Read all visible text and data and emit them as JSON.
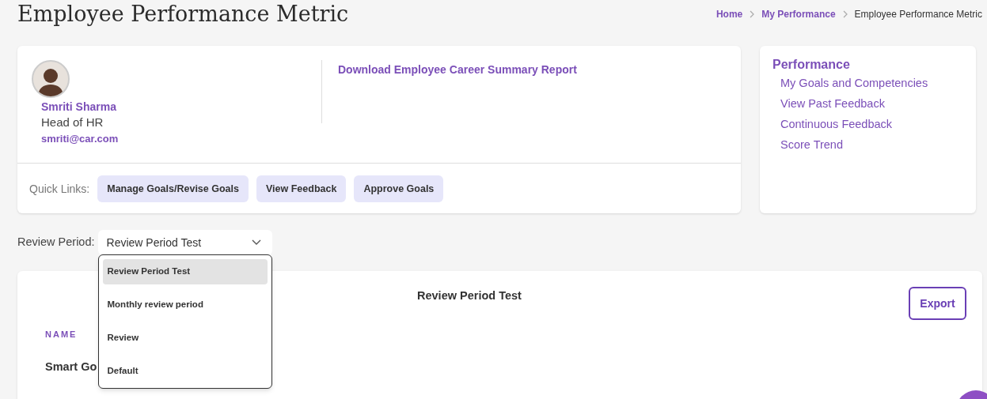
{
  "page_title": "Employee Performance Metric",
  "breadcrumb": [
    {
      "label": "Home",
      "link": true
    },
    {
      "label": "My Performance",
      "link": true
    },
    {
      "label": "Employee Performance Metric",
      "link": false
    }
  ],
  "profile": {
    "name": "Smriti Sharma",
    "role": "Head of HR",
    "email": "smriti@car.com"
  },
  "report_link": "Download Employee Career Summary Report",
  "quick_links": {
    "label": "Quick Links:",
    "buttons": [
      "Manage Goals/Revise Goals",
      "View Feedback",
      "Approve Goals"
    ]
  },
  "performance_menu": {
    "title": "Performance",
    "items": [
      "My Goals and Competencies",
      "View Past Feedback",
      "Continuous Feedback",
      "Score Trend"
    ]
  },
  "review_period": {
    "label": "Review Period:",
    "value": "Review Period Test",
    "expanded": true,
    "options": [
      {
        "label": "Review Period Test",
        "selected": true
      },
      {
        "label": "Monthly review period",
        "selected": false
      },
      {
        "label": "Review",
        "selected": false
      },
      {
        "label": "Default",
        "selected": false
      }
    ]
  },
  "report": {
    "title": "Review Period Test",
    "export_button": "Export",
    "column_header": "NAME",
    "row_1": "Smart Go"
  }
}
